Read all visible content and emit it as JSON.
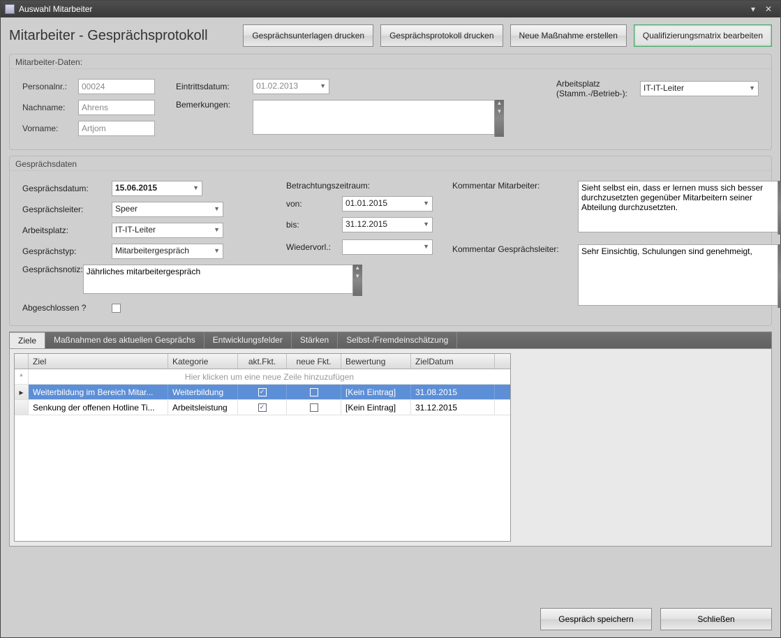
{
  "window": {
    "title": "Auswahl Mitarbeiter"
  },
  "header": {
    "page_title": "Mitarbeiter - Gesprächsprotokoll",
    "buttons": {
      "print_docs": "Gesprächsunterlagen drucken",
      "print_protocol": "Gesprächsprotokoll drucken",
      "new_measure": "Neue Maßnahme erstellen",
      "edit_matrix": "Qualifizierungsmatrix bearbeiten"
    }
  },
  "employee": {
    "group_title": "Mitarbeiter-Daten:",
    "labels": {
      "personalnr": "Personalnr.:",
      "nachname": "Nachname:",
      "vorname": "Vorname:",
      "eintritt": "Eintrittsdatum:",
      "bemerkungen": "Bemerkungen:",
      "arbeitsplatz": "Arbeitsplatz (Stamm.-/Betrieb-):"
    },
    "personalnr": "00024",
    "nachname": "Ahrens",
    "vorname": "Artjom",
    "eintritt": "01.02.2013",
    "bemerkungen": "",
    "arbeitsplatz": "IT-IT-Leiter"
  },
  "conversation": {
    "group_title": "Gesprächsdaten",
    "labels": {
      "datum": "Gesprächsdatum:",
      "leiter": "Gesprächsleiter:",
      "arbeitsplatz": "Arbeitsplatz:",
      "typ": "Gesprächstyp:",
      "notiz": "Gesprächsnotiz:",
      "abgeschlossen": "Abgeschlossen ?",
      "zeitraum": "Betrachtungszeitraum:",
      "von": "von:",
      "bis": "bis:",
      "wiedervorl": "Wiedervorl.:",
      "komm_ma": "Kommentar Mitarbeiter:",
      "komm_gl": "Kommentar Gesprächsleiter:"
    },
    "datum": "15.06.2015",
    "leiter": "Speer",
    "arbeitsplatz": "IT-IT-Leiter",
    "typ": "Mitarbeitergespräch",
    "notiz": "Jährliches mitarbeitergespräch",
    "abgeschlossen": false,
    "von": "01.01.2015",
    "bis": "31.12.2015",
    "wiedervorl": "",
    "komm_ma": "Sieht selbst ein, dass er lernen muss sich besser durchzusetzten gegenüber Mitarbeitern seiner Abteilung durchzusetzten.",
    "komm_gl": "Sehr Einsichtig, Schulungen sind genehmeigt,"
  },
  "tabs": {
    "ziele": "Ziele",
    "massnahmen": "Maßnahmen  des aktuellen Gesprächs",
    "entwicklung": "Entwicklungsfelder",
    "staerken": "Stärken",
    "einschaetzung": "Selbst-/Fremdeinschätzung"
  },
  "grid": {
    "columns": {
      "ziel": "Ziel",
      "kategorie": "Kategorie",
      "aktfkt": "akt.Fkt.",
      "neufkt": "neue Fkt.",
      "bewertung": "Bewertung",
      "zieldatum": "ZielDatum"
    },
    "new_row_hint": "Hier klicken um eine neue Zeile hinzuzufügen",
    "rows": [
      {
        "ziel": "Weiterbildung im Bereich Mitar...",
        "kategorie": "Weiterbildung",
        "aktfkt": true,
        "neufkt": false,
        "bewertung": "[Kein Eintrag]",
        "zieldatum": "31.08.2015",
        "selected": true
      },
      {
        "ziel": "Senkung der offenen Hotline Ti...",
        "kategorie": "Arbeitsleistung",
        "aktfkt": true,
        "neufkt": false,
        "bewertung": "[Kein Eintrag]",
        "zieldatum": "31.12.2015",
        "selected": false
      }
    ]
  },
  "footer": {
    "save": "Gespräch speichern",
    "close": "Schließen"
  }
}
